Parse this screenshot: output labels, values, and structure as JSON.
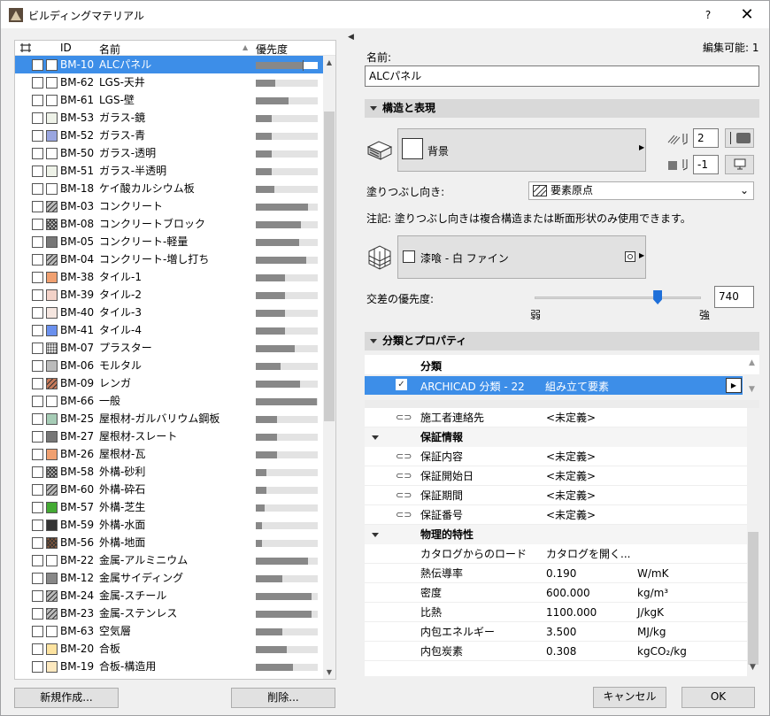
{
  "window": {
    "title": "ビルディングマテリアル",
    "help": "?",
    "close": "✕"
  },
  "list": {
    "headers": {
      "icon": "layers-icon",
      "id": "ID",
      "name": "名前",
      "priority": "優先度"
    },
    "rows": [
      {
        "id": "BM-10",
        "name": "ALCパネル",
        "priority": 0.77,
        "swatch": "#ffffff",
        "selected": true
      },
      {
        "id": "BM-62",
        "name": "LGS-天井",
        "priority": 0.32,
        "swatch": "#ffffff"
      },
      {
        "id": "BM-61",
        "name": "LGS-壁",
        "priority": 0.53,
        "swatch": "#ffffff"
      },
      {
        "id": "BM-53",
        "name": "ガラス-鏡",
        "priority": 0.26,
        "swatch": "#eef2e8"
      },
      {
        "id": "BM-52",
        "name": "ガラス-青",
        "priority": 0.26,
        "swatch": "#9aa6e0"
      },
      {
        "id": "BM-50",
        "name": "ガラス-透明",
        "priority": 0.26,
        "swatch": "#ffffff"
      },
      {
        "id": "BM-51",
        "name": "ガラス-半透明",
        "priority": 0.26,
        "swatch": "#eef2e8"
      },
      {
        "id": "BM-18",
        "name": "ケイ酸カルシウム板",
        "priority": 0.3,
        "swatch": "#ffffff"
      },
      {
        "id": "BM-03",
        "name": "コンクリート",
        "priority": 0.84,
        "swatch": "#bbbbbb",
        "hatch": "diag"
      },
      {
        "id": "BM-08",
        "name": "コンクリートブロック",
        "priority": 0.73,
        "swatch": "#cccccc",
        "hatch": "cross"
      },
      {
        "id": "BM-05",
        "name": "コンクリート-軽量",
        "priority": 0.7,
        "swatch": "#777777"
      },
      {
        "id": "BM-04",
        "name": "コンクリート-増し打ち",
        "priority": 0.81,
        "swatch": "#bbbbbb",
        "hatch": "diag"
      },
      {
        "id": "BM-38",
        "name": "タイル-1",
        "priority": 0.47,
        "swatch": "#f0a070"
      },
      {
        "id": "BM-39",
        "name": "タイル-2",
        "priority": 0.47,
        "swatch": "#f3d2c8"
      },
      {
        "id": "BM-40",
        "name": "タイル-3",
        "priority": 0.47,
        "swatch": "#f5e6e0"
      },
      {
        "id": "BM-41",
        "name": "タイル-4",
        "priority": 0.47,
        "swatch": "#6a90ee"
      },
      {
        "id": "BM-07",
        "name": "プラスター",
        "priority": 0.63,
        "swatch": "#dddddd",
        "hatch": "dot"
      },
      {
        "id": "BM-06",
        "name": "モルタル",
        "priority": 0.4,
        "swatch": "#bbbbbb"
      },
      {
        "id": "BM-09",
        "name": "レンガ",
        "priority": 0.71,
        "swatch": "#c77a5a",
        "hatch": "diag"
      },
      {
        "id": "BM-66",
        "name": "一般",
        "priority": 0.98,
        "swatch": "#ffffff"
      },
      {
        "id": "BM-25",
        "name": "屋根材-ガルバリウム鋼板",
        "priority": 0.34,
        "swatch": "#a6ccb6"
      },
      {
        "id": "BM-27",
        "name": "屋根材-スレート",
        "priority": 0.34,
        "swatch": "#777777"
      },
      {
        "id": "BM-26",
        "name": "屋根材-瓦",
        "priority": 0.34,
        "swatch": "#f0a070"
      },
      {
        "id": "BM-58",
        "name": "外構-砂利",
        "priority": 0.17,
        "swatch": "#cccccc",
        "hatch": "cross"
      },
      {
        "id": "BM-60",
        "name": "外構-砕石",
        "priority": 0.17,
        "swatch": "#bbbbbb",
        "hatch": "diag"
      },
      {
        "id": "BM-57",
        "name": "外構-芝生",
        "priority": 0.14,
        "swatch": "#44aa33"
      },
      {
        "id": "BM-59",
        "name": "外構-水面",
        "priority": 0.1,
        "swatch": "#333333"
      },
      {
        "id": "BM-56",
        "name": "外構-地面",
        "priority": 0.1,
        "swatch": "#8a5a3c",
        "hatch": "cross"
      },
      {
        "id": "BM-22",
        "name": "金属-アルミニウム",
        "priority": 0.84,
        "swatch": "#ffffff"
      },
      {
        "id": "BM-12",
        "name": "金属サイディング",
        "priority": 0.43,
        "swatch": "#888888"
      },
      {
        "id": "BM-24",
        "name": "金属-スチール",
        "priority": 0.9,
        "swatch": "#bbbbbb",
        "hatch": "diag"
      },
      {
        "id": "BM-23",
        "name": "金属-ステンレス",
        "priority": 0.9,
        "swatch": "#bbbbbb",
        "hatch": "diag"
      },
      {
        "id": "BM-63",
        "name": "空気層",
        "priority": 0.43,
        "swatch": "#ffffff"
      },
      {
        "id": "BM-20",
        "name": "合板",
        "priority": 0.5,
        "swatch": "#fde3a0"
      },
      {
        "id": "BM-19",
        "name": "合板-構造用",
        "priority": 0.6,
        "swatch": "#fde9bf"
      }
    ]
  },
  "left_buttons": {
    "new": "新規作成...",
    "delete": "削除..."
  },
  "right": {
    "editable": "編集可能: 1",
    "name_label": "名前:",
    "name_value": "ALCパネル",
    "section_structure": "構造と表現",
    "cut_fill_name": "背景",
    "pen1": "2",
    "pen2": "-1",
    "fill_orientation_label": "塗りつぶし向き:",
    "fill_orientation_value": "要素原点",
    "note": "注記: 塗りつぶし向きは複合構造または断面形状のみ使用できます。",
    "surface_name": "漆喰 - 白 ファイン",
    "intersection_label": "交差の優先度:",
    "intersection_value": "740",
    "intersection_level": 0.74,
    "weak": "弱",
    "strong": "強",
    "section_props": "分類とプロパティ",
    "class_header": "分類",
    "class_name": "ARCHICAD 分類 - 22",
    "class_value": "組み立て要素",
    "props": [
      {
        "type": "row",
        "k": "施工者連絡先",
        "v": "<未定義>",
        "icon": true
      },
      {
        "type": "group",
        "k": "保証情報"
      },
      {
        "type": "row",
        "k": "保証内容",
        "v": "<未定義>",
        "icon": true
      },
      {
        "type": "row",
        "k": "保証開始日",
        "v": "<未定義>",
        "icon": true
      },
      {
        "type": "row",
        "k": "保証期間",
        "v": "<未定義>",
        "icon": true
      },
      {
        "type": "row",
        "k": "保証番号",
        "v": "<未定義>",
        "icon": true
      },
      {
        "type": "group",
        "k": "物理的特性"
      },
      {
        "type": "row",
        "k": "カタログからのロード",
        "v": "カタログを開く..."
      },
      {
        "type": "row",
        "k": "熱伝導率",
        "v": "0.190",
        "u": "W/mK"
      },
      {
        "type": "row",
        "k": "密度",
        "v": "600.000",
        "u": "kg/m³"
      },
      {
        "type": "row",
        "k": "比熱",
        "v": "1100.000",
        "u": "J/kgK"
      },
      {
        "type": "row",
        "k": "内包エネルギー",
        "v": "3.500",
        "u": "MJ/kg"
      },
      {
        "type": "row",
        "k": "内包炭素",
        "v": "0.308",
        "u": "kgCO₂/kg"
      }
    ],
    "cancel": "キャンセル",
    "ok": "OK"
  }
}
